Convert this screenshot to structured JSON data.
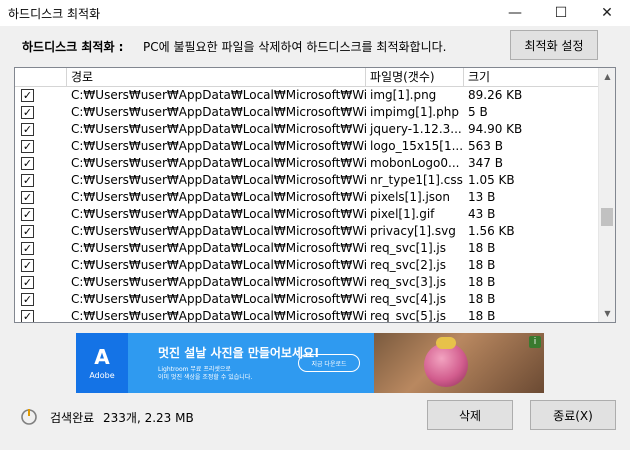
{
  "window": {
    "title": "하드디스크 최적화",
    "minimize": "—",
    "maximize": "☐",
    "close": "✕"
  },
  "header": {
    "label": "하드디스크 최적화 :",
    "description": "PC에 불필요한 파일을 삭제하여 하드디스크를 최적화합니다.",
    "settings_button": "최적화 설정"
  },
  "table": {
    "columns": [
      "",
      "경로",
      "파일명(갯수)",
      "크기"
    ],
    "rows": [
      {
        "checked": true,
        "path": "C:₩Users₩user₩AppData₩Local₩Microsoft₩Win...",
        "name": "img[1].png",
        "size": "89.26 KB"
      },
      {
        "checked": true,
        "path": "C:₩Users₩user₩AppData₩Local₩Microsoft₩Win...",
        "name": "impimg[1].php",
        "size": "5 B"
      },
      {
        "checked": true,
        "path": "C:₩Users₩user₩AppData₩Local₩Microsoft₩Win...",
        "name": "jquery-1.12.3...",
        "size": "94.90 KB"
      },
      {
        "checked": true,
        "path": "C:₩Users₩user₩AppData₩Local₩Microsoft₩Win...",
        "name": "logo_15x15[1...",
        "size": "563 B"
      },
      {
        "checked": true,
        "path": "C:₩Users₩user₩AppData₩Local₩Microsoft₩Win...",
        "name": "mobonLogo0...",
        "size": "347 B"
      },
      {
        "checked": true,
        "path": "C:₩Users₩user₩AppData₩Local₩Microsoft₩Win...",
        "name": "nr_type1[1].css",
        "size": "1.05 KB"
      },
      {
        "checked": true,
        "path": "C:₩Users₩user₩AppData₩Local₩Microsoft₩Win...",
        "name": "pixels[1].json",
        "size": "13 B"
      },
      {
        "checked": true,
        "path": "C:₩Users₩user₩AppData₩Local₩Microsoft₩Win...",
        "name": "pixel[1].gif",
        "size": "43 B"
      },
      {
        "checked": true,
        "path": "C:₩Users₩user₩AppData₩Local₩Microsoft₩Win...",
        "name": "privacy[1].svg",
        "size": "1.56 KB"
      },
      {
        "checked": true,
        "path": "C:₩Users₩user₩AppData₩Local₩Microsoft₩Win...",
        "name": "req_svc[1].js",
        "size": "18 B"
      },
      {
        "checked": true,
        "path": "C:₩Users₩user₩AppData₩Local₩Microsoft₩Win...",
        "name": "req_svc[2].js",
        "size": "18 B"
      },
      {
        "checked": true,
        "path": "C:₩Users₩user₩AppData₩Local₩Microsoft₩Win...",
        "name": "req_svc[3].js",
        "size": "18 B"
      },
      {
        "checked": true,
        "path": "C:₩Users₩user₩AppData₩Local₩Microsoft₩Win...",
        "name": "req_svc[4].js",
        "size": "18 B"
      },
      {
        "checked": true,
        "path": "C:₩Users₩user₩AppData₩Local₩Microsoft₩Win...",
        "name": "req_svc[5].js",
        "size": "18 B"
      }
    ]
  },
  "ad": {
    "brand": "Adobe",
    "headline": "멋진 설날 사진을 만들어보세요!",
    "sub1": "Lightroom 무료 프리셋으로",
    "sub2": "이미 멋진 색상을 조정할 수 있습니다.",
    "cta": "지금 다운로드",
    "info": "i"
  },
  "status": {
    "label": "검색완료",
    "count": "233개, 2.23 MB"
  },
  "buttons": {
    "delete": "삭제",
    "close": "종료(X)"
  },
  "colors": {
    "ad_background": "#2f9af0",
    "adobe_blue": "#1473e6",
    "window_bg": "#f0f0f0"
  }
}
